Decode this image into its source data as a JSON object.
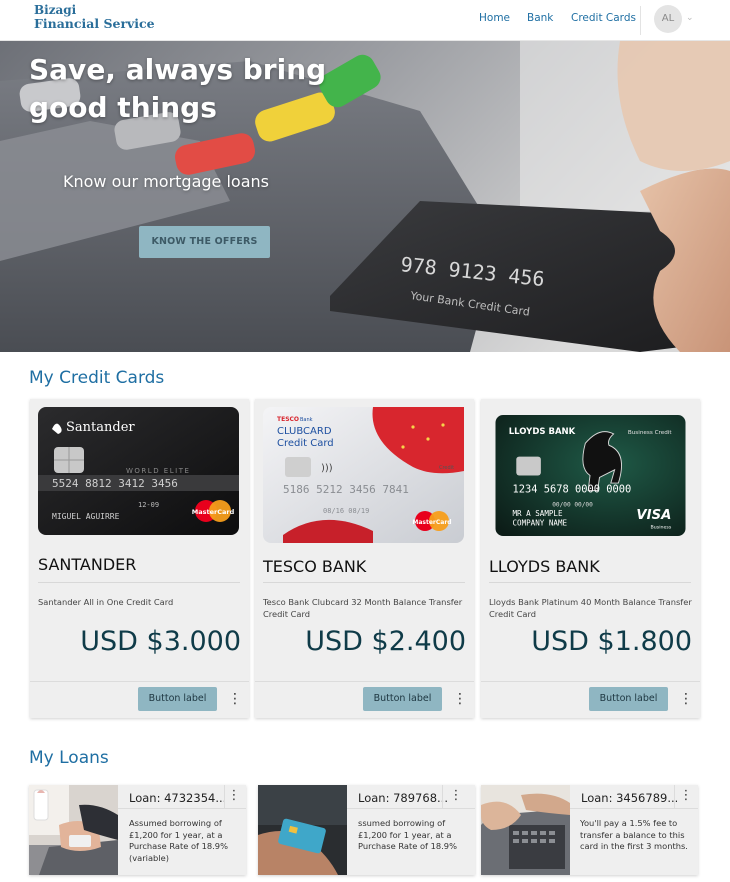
{
  "header": {
    "logo_line1": "Bizagi",
    "logo_line2": "Financial Service",
    "nav": [
      {
        "label": "Home"
      },
      {
        "label": "Bank"
      },
      {
        "label": "Credit Cards"
      }
    ],
    "avatar_initials": "AL"
  },
  "hero": {
    "title_line1": "Save, always bring",
    "title_line2": "good things",
    "subtitle": "Know our mortgage loans",
    "cta_label": "KNOW THE OFFERS"
  },
  "credit_cards_section": {
    "title": "My Credit Cards",
    "cards": [
      {
        "name": "SANTANDER",
        "description": "Santander All in One Credit Card",
        "price": "USD $3.000",
        "button_label": "Button label",
        "image": {
          "brand": "Santander",
          "tier": "WORLD ELITE",
          "number": "5524 8812 3412 3456",
          "expiry": "12-09",
          "holder": "MIGUEL AGUIRRE",
          "network": "MasterCard"
        }
      },
      {
        "name": "TESCO BANK",
        "description": "Tesco Bank Clubcard 32 Month Balance Transfer Credit Card",
        "price": "USD $2.400",
        "button_label": "Button label",
        "image": {
          "brand_small": "TESCO",
          "brand_sub": "Bank",
          "product_line1": "CLUBCARD",
          "product_line2": "Credit Card",
          "number": "5186 5212 3456 7841",
          "dates": "08/16   08/19",
          "type_label": "Credit",
          "network": "MasterCard"
        }
      },
      {
        "name": "LLOYDS BANK",
        "description": "Lloyds Bank Platinum 40 Month Balance Transfer Credit Card",
        "price": "USD $1.800",
        "button_label": "Button label",
        "image": {
          "brand": "LLOYDS BANK",
          "tier": "Business Credit",
          "number": "1234 5678 0000 0000",
          "dates": "00/00   00/00",
          "holder_line1": "MR A SAMPLE",
          "holder_line2": "COMPANY NAME",
          "network": "VISA",
          "network_sub": "Business"
        }
      }
    ]
  },
  "loans_section": {
    "title": "My Loans",
    "loans": [
      {
        "title": "Loan: 4732354...",
        "description_lines": [
          "Assumed borrowing of",
          "£1,200 for 1 year, at a",
          "Purchase Rate of 18.9%",
          "(variable)"
        ]
      },
      {
        "title": "Loan: 789768...",
        "description_lines": [
          "ssumed borrowing of",
          "£1,200 for 1 year, at a",
          "Purchase Rate of 18.9%"
        ]
      },
      {
        "title": "Loan: 3456789...",
        "description_lines": [
          "You'll pay a 1.5% fee to",
          "transfer a balance to this",
          "card in the first 3 months."
        ]
      }
    ]
  },
  "colors": {
    "brand_blue": "#1f6fa3",
    "button_teal": "#8fb6c2",
    "price_navy": "#0f3b48",
    "card_bg": "#efefef"
  }
}
